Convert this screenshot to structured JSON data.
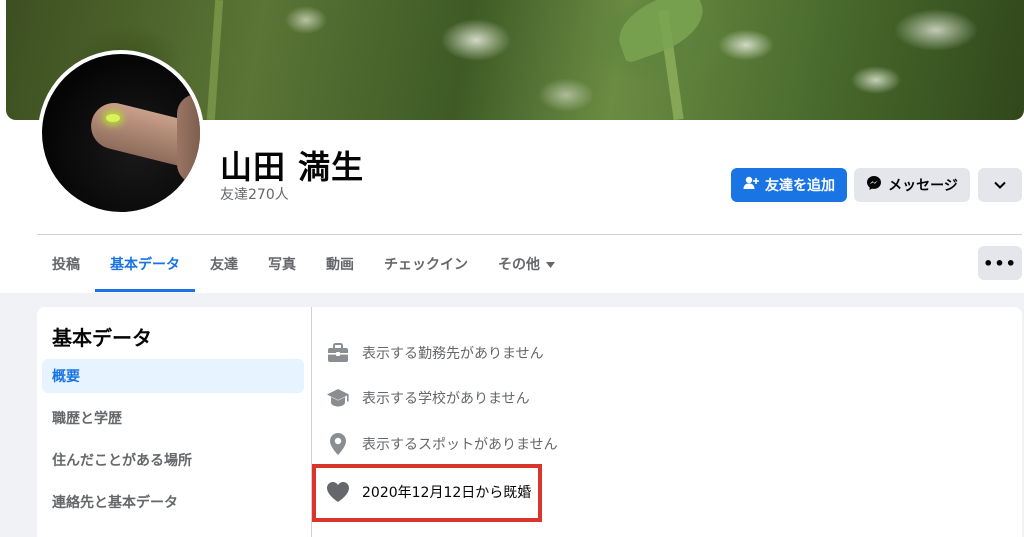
{
  "profile": {
    "name": "山田 満生",
    "friends_count": "友達270人"
  },
  "actions": {
    "add_friend": "友達を追加",
    "message": "メッセージ"
  },
  "tabs": [
    {
      "label": "投稿"
    },
    {
      "label": "基本データ"
    },
    {
      "label": "友達"
    },
    {
      "label": "写真"
    },
    {
      "label": "動画"
    },
    {
      "label": "チェックイン"
    },
    {
      "label": "その他"
    }
  ],
  "about": {
    "title": "基本データ",
    "sidebar": [
      {
        "label": "概要"
      },
      {
        "label": "職歴と学歴"
      },
      {
        "label": "住んだことがある場所"
      },
      {
        "label": "連絡先と基本データ"
      }
    ],
    "overview": [
      {
        "icon": "briefcase-icon",
        "text": "表示する勤務先がありません"
      },
      {
        "icon": "graduation-cap-icon",
        "text": "表示する学校がありません"
      },
      {
        "icon": "location-pin-icon",
        "text": "表示するスポットがありません"
      },
      {
        "icon": "heart-icon",
        "text": "2020年12月12日から既婚"
      }
    ]
  },
  "colors": {
    "accent": "#1b74e4",
    "highlight_box": "#d9352b",
    "secondary_text": "#65676b"
  }
}
